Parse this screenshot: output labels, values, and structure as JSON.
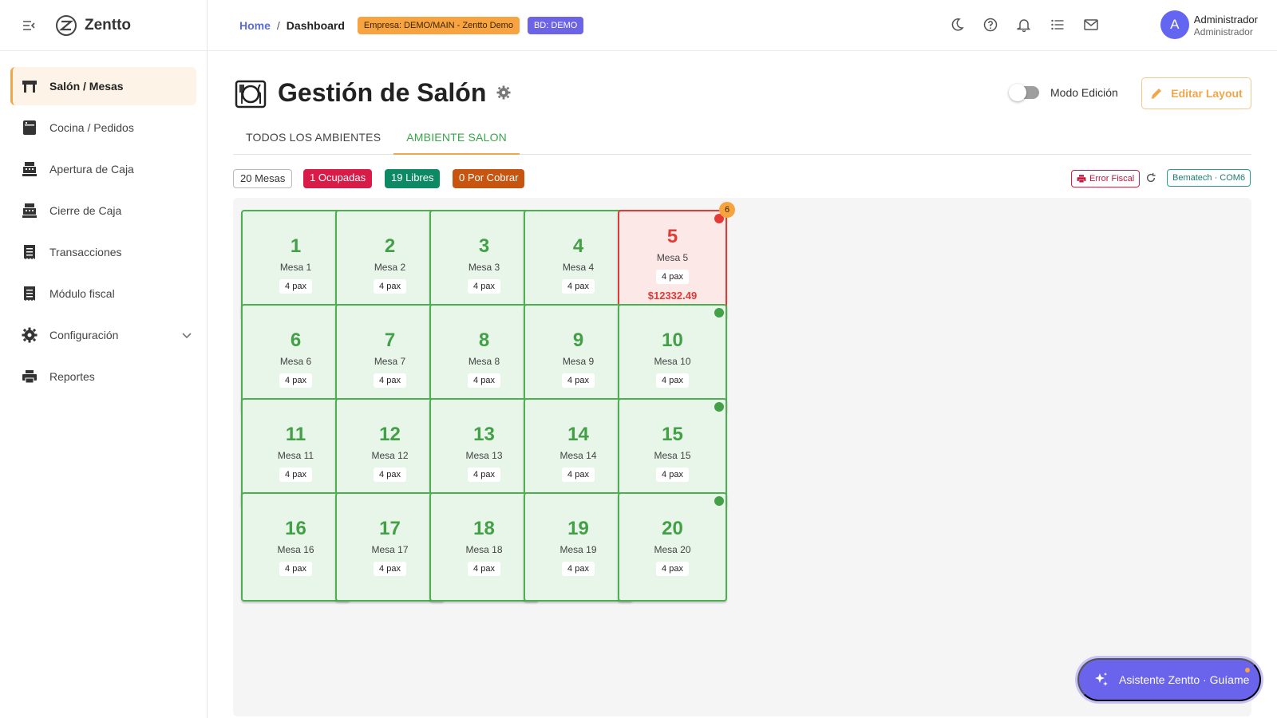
{
  "brand": {
    "name": "Zentto"
  },
  "sidebar": {
    "items": [
      {
        "label": "Salón / Mesas",
        "icon": "table-icon",
        "active": true
      },
      {
        "label": "Cocina / Pedidos",
        "icon": "kitchen-icon"
      },
      {
        "label": "Apertura de Caja",
        "icon": "cash-register-icon"
      },
      {
        "label": "Cierre de Caja",
        "icon": "cash-register-icon"
      },
      {
        "label": "Transacciones",
        "icon": "receipt-icon"
      },
      {
        "label": "Módulo fiscal",
        "icon": "receipt-icon"
      },
      {
        "label": "Configuración",
        "icon": "gear-icon",
        "expandable": true
      },
      {
        "label": "Reportes",
        "icon": "printer-icon"
      }
    ]
  },
  "header": {
    "breadcrumb": {
      "home": "Home",
      "separator": "/",
      "current": "Dashboard"
    },
    "empresa_tag": "Empresa: DEMO/MAIN - Zentto Demo",
    "bd_tag": "BD: DEMO",
    "icons": [
      "moon-icon",
      "help-icon",
      "bell-icon",
      "list-icon",
      "mail-icon"
    ],
    "user": {
      "initial": "A",
      "name": "Administrador",
      "role": "Administrador"
    }
  },
  "page": {
    "title": "Gestión de Salón",
    "mode_label": "Modo Edición",
    "edit_layout_label": "Editar Layout",
    "tabs": [
      {
        "label": "TODOS LOS AMBIENTES",
        "active": false
      },
      {
        "label": "AMBIENTE SALON",
        "active": true
      }
    ],
    "summary": {
      "total": "20 Mesas",
      "busy": "1 Ocupadas",
      "free": "19 Libres",
      "to_charge": "0 Por Cobrar"
    },
    "fiscal_status": "Error Fiscal",
    "printer": "Bematech · COM6"
  },
  "tables": [
    {
      "number": "1",
      "name": "Mesa 1",
      "pax": "4 pax",
      "status": "free"
    },
    {
      "number": "2",
      "name": "Mesa 2",
      "pax": "4 pax",
      "status": "free"
    },
    {
      "number": "3",
      "name": "Mesa 3",
      "pax": "4 pax",
      "status": "free"
    },
    {
      "number": "4",
      "name": "Mesa 4",
      "pax": "4 pax",
      "status": "free"
    },
    {
      "number": "5",
      "name": "Mesa 5",
      "pax": "4 pax",
      "status": "busy",
      "amount": "$12332.49",
      "badge": "6",
      "dot": true
    },
    {
      "number": "6",
      "name": "Mesa 6",
      "pax": "4 pax",
      "status": "free"
    },
    {
      "number": "7",
      "name": "Mesa 7",
      "pax": "4 pax",
      "status": "free"
    },
    {
      "number": "8",
      "name": "Mesa 8",
      "pax": "4 pax",
      "status": "free"
    },
    {
      "number": "9",
      "name": "Mesa 9",
      "pax": "4 pax",
      "status": "free"
    },
    {
      "number": "10",
      "name": "Mesa 10",
      "pax": "4 pax",
      "status": "free",
      "dot": true
    },
    {
      "number": "11",
      "name": "Mesa 11",
      "pax": "4 pax",
      "status": "free"
    },
    {
      "number": "12",
      "name": "Mesa 12",
      "pax": "4 pax",
      "status": "free"
    },
    {
      "number": "13",
      "name": "Mesa 13",
      "pax": "4 pax",
      "status": "free"
    },
    {
      "number": "14",
      "name": "Mesa 14",
      "pax": "4 pax",
      "status": "free"
    },
    {
      "number": "15",
      "name": "Mesa 15",
      "pax": "4 pax",
      "status": "free",
      "dot": true
    },
    {
      "number": "16",
      "name": "Mesa 16",
      "pax": "4 pax",
      "status": "free"
    },
    {
      "number": "17",
      "name": "Mesa 17",
      "pax": "4 pax",
      "status": "free"
    },
    {
      "number": "18",
      "name": "Mesa 18",
      "pax": "4 pax",
      "status": "free"
    },
    {
      "number": "19",
      "name": "Mesa 19",
      "pax": "4 pax",
      "status": "free"
    },
    {
      "number": "20",
      "name": "Mesa 20",
      "pax": "4 pax",
      "status": "free",
      "dot": true
    }
  ],
  "assistant": {
    "label": "Asistente Zentto · Guíame"
  },
  "colors": {
    "accent": "#f0a64a",
    "free": "#43a047",
    "busy": "#e53935",
    "brand_purple": "#6a63ec"
  }
}
